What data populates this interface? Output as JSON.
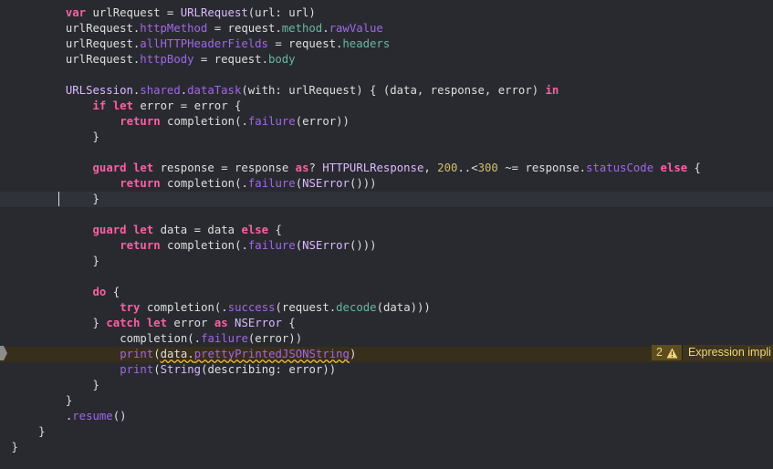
{
  "lines": [
    {
      "indent": 8,
      "tokens": [
        [
          "kw",
          "var"
        ],
        [
          "pl",
          " urlRequest = "
        ],
        [
          "tp",
          "URLRequest"
        ],
        [
          "pl",
          "(url: url)"
        ]
      ]
    },
    {
      "indent": 8,
      "tokens": [
        [
          "pl",
          "urlRequest."
        ],
        [
          "ot",
          "httpMethod"
        ],
        [
          "pl",
          " = request."
        ],
        [
          "pr",
          "method"
        ],
        [
          "pl",
          "."
        ],
        [
          "ot",
          "rawValue"
        ]
      ]
    },
    {
      "indent": 8,
      "tokens": [
        [
          "pl",
          "urlRequest."
        ],
        [
          "ot",
          "allHTTPHeaderFields"
        ],
        [
          "pl",
          " = request."
        ],
        [
          "pr",
          "headers"
        ]
      ]
    },
    {
      "indent": 8,
      "tokens": [
        [
          "pl",
          "urlRequest."
        ],
        [
          "ot",
          "httpBody"
        ],
        [
          "pl",
          " = request."
        ],
        [
          "pr",
          "body"
        ]
      ]
    },
    {
      "indent": 8,
      "tokens": []
    },
    {
      "indent": 8,
      "tokens": [
        [
          "tp",
          "URLSession"
        ],
        [
          "pl",
          "."
        ],
        [
          "ot",
          "shared"
        ],
        [
          "pl",
          "."
        ],
        [
          "ot",
          "dataTask"
        ],
        [
          "pl",
          "(with: urlRequest) { (data, response, error) "
        ],
        [
          "kw",
          "in"
        ]
      ]
    },
    {
      "indent": 12,
      "tokens": [
        [
          "kw",
          "if"
        ],
        [
          "pl",
          " "
        ],
        [
          "kw",
          "let"
        ],
        [
          "pl",
          " error = error {"
        ]
      ]
    },
    {
      "indent": 16,
      "tokens": [
        [
          "kw",
          "return"
        ],
        [
          "pl",
          " completion(."
        ],
        [
          "ot",
          "failure"
        ],
        [
          "pl",
          "(error))"
        ]
      ]
    },
    {
      "indent": 12,
      "tokens": [
        [
          "pl",
          "}"
        ]
      ]
    },
    {
      "indent": 12,
      "tokens": []
    },
    {
      "indent": 12,
      "tokens": [
        [
          "kw",
          "guard"
        ],
        [
          "pl",
          " "
        ],
        [
          "kw",
          "let"
        ],
        [
          "pl",
          " response = response "
        ],
        [
          "kw",
          "as"
        ],
        [
          "pl",
          "? "
        ],
        [
          "tp",
          "HTTPURLResponse"
        ],
        [
          "pl",
          ", "
        ],
        [
          "nu",
          "200"
        ],
        [
          "pl",
          "..<"
        ],
        [
          "nu",
          "300"
        ],
        [
          "pl",
          " ~= response."
        ],
        [
          "ot",
          "statusCode"
        ],
        [
          "pl",
          " "
        ],
        [
          "kw",
          "else"
        ],
        [
          "pl",
          " {"
        ]
      ]
    },
    {
      "indent": 16,
      "tokens": [
        [
          "kw",
          "return"
        ],
        [
          "pl",
          " completion(."
        ],
        [
          "ot",
          "failure"
        ],
        [
          "pl",
          "("
        ],
        [
          "tp",
          "NSError"
        ],
        [
          "pl",
          "()))"
        ]
      ]
    },
    {
      "indent": 12,
      "tokens": [
        [
          "pl",
          "}"
        ]
      ],
      "current": true
    },
    {
      "indent": 12,
      "tokens": []
    },
    {
      "indent": 12,
      "tokens": [
        [
          "kw",
          "guard"
        ],
        [
          "pl",
          " "
        ],
        [
          "kw",
          "let"
        ],
        [
          "pl",
          " data = data "
        ],
        [
          "kw",
          "else"
        ],
        [
          "pl",
          " {"
        ]
      ]
    },
    {
      "indent": 16,
      "tokens": [
        [
          "kw",
          "return"
        ],
        [
          "pl",
          " completion(."
        ],
        [
          "ot",
          "failure"
        ],
        [
          "pl",
          "("
        ],
        [
          "tp",
          "NSError"
        ],
        [
          "pl",
          "()))"
        ]
      ]
    },
    {
      "indent": 12,
      "tokens": [
        [
          "pl",
          "}"
        ]
      ]
    },
    {
      "indent": 12,
      "tokens": []
    },
    {
      "indent": 12,
      "tokens": [
        [
          "kw",
          "do"
        ],
        [
          "pl",
          " {"
        ]
      ]
    },
    {
      "indent": 16,
      "tokens": [
        [
          "kw",
          "try"
        ],
        [
          "pl",
          " completion(."
        ],
        [
          "ot",
          "success"
        ],
        [
          "pl",
          "(request."
        ],
        [
          "pr",
          "decode"
        ],
        [
          "pl",
          "(data)))"
        ]
      ]
    },
    {
      "indent": 12,
      "tokens": [
        [
          "pl",
          "} "
        ],
        [
          "kw",
          "catch"
        ],
        [
          "pl",
          " "
        ],
        [
          "kw",
          "let"
        ],
        [
          "pl",
          " error "
        ],
        [
          "kw",
          "as"
        ],
        [
          "pl",
          " "
        ],
        [
          "tp",
          "NSError"
        ],
        [
          "pl",
          " {"
        ]
      ]
    },
    {
      "indent": 16,
      "tokens": [
        [
          "pl",
          "completion(."
        ],
        [
          "ot",
          "failure"
        ],
        [
          "pl",
          "(error))"
        ]
      ]
    },
    {
      "indent": 16,
      "tokens": [
        [
          "ot",
          "print"
        ],
        [
          "pl",
          "("
        ],
        [
          "sqpl",
          "data."
        ],
        [
          "sqot",
          "prettyPrintedJSONString"
        ],
        [
          "pl",
          ")"
        ]
      ],
      "warn": true
    },
    {
      "indent": 16,
      "tokens": [
        [
          "ot",
          "print"
        ],
        [
          "pl",
          "("
        ],
        [
          "tp",
          "String"
        ],
        [
          "pl",
          "(describing: error))"
        ]
      ]
    },
    {
      "indent": 12,
      "tokens": [
        [
          "pl",
          "}"
        ]
      ]
    },
    {
      "indent": 8,
      "tokens": [
        [
          "pl",
          "}"
        ]
      ]
    },
    {
      "indent": 8,
      "tokens": [
        [
          "pl",
          "."
        ],
        [
          "ot",
          "resume"
        ],
        [
          "pl",
          "()"
        ]
      ]
    },
    {
      "indent": 4,
      "tokens": [
        [
          "pl",
          "}"
        ]
      ]
    },
    {
      "indent": 0,
      "tokens": [
        [
          "pl",
          "}"
        ]
      ]
    }
  ],
  "issue": {
    "count": "2",
    "message": "Expression impli",
    "icon": "warning-triangle-icon",
    "color": "#f3d777"
  },
  "colors": {
    "background": "#292a30",
    "keyword": "#fc5fa3",
    "type": "#dabaff",
    "property": "#67b7a4",
    "method": "#a167e6",
    "number": "#d0bf69",
    "plain": "#dfdfe0"
  }
}
